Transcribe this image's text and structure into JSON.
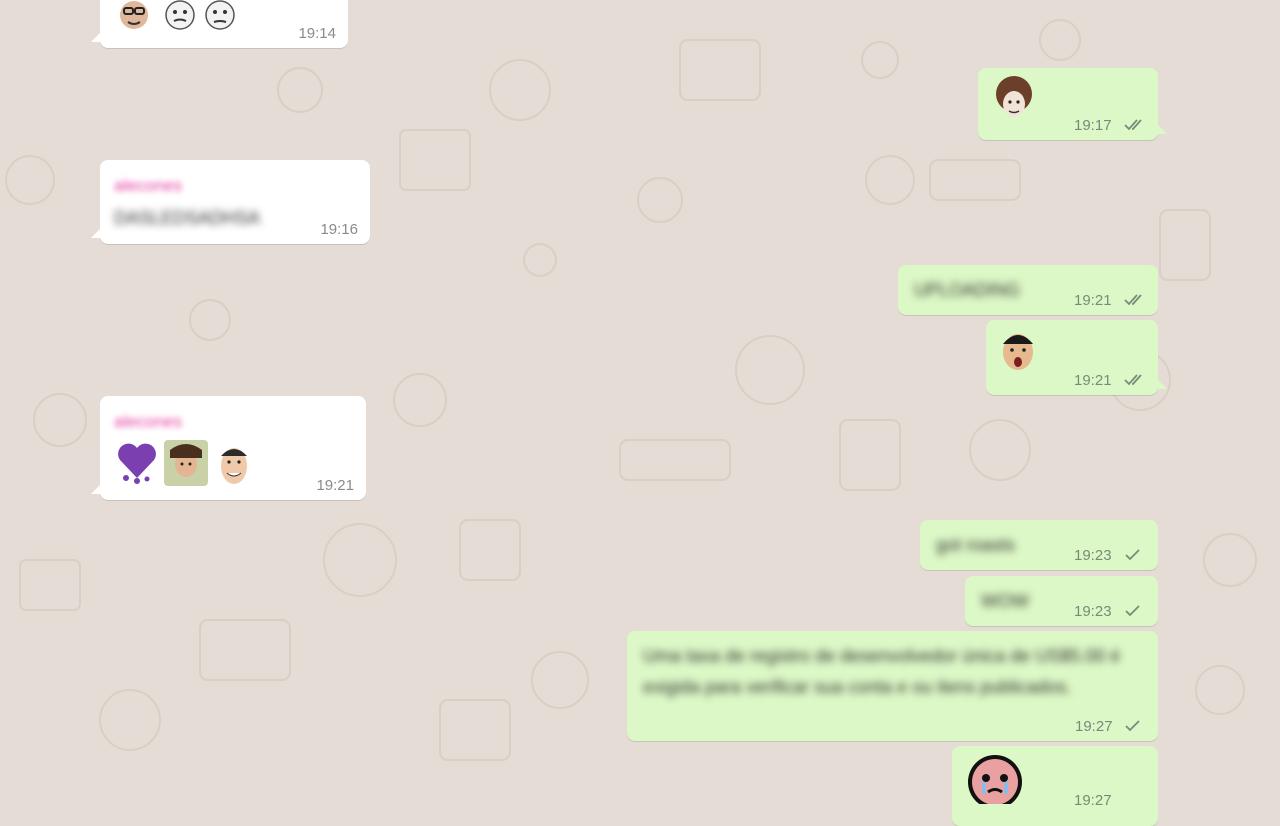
{
  "chat": {
    "messages": [
      {
        "id": "m1",
        "direction": "in",
        "stickers": [
          "face-glasses-emoji",
          "face-bald-emoji",
          "face-bald-emoji-2"
        ],
        "time": "19:14"
      },
      {
        "id": "m2",
        "direction": "out",
        "stickers": [
          "afro-face-emoji"
        ],
        "time": "19:17",
        "status": "read"
      },
      {
        "id": "m3",
        "direction": "in",
        "sender": "alecones",
        "text": "DASLEDSADHSA",
        "time": "19:16"
      },
      {
        "id": "m4",
        "direction": "out",
        "text": "UPLOADING",
        "time": "19:21",
        "status": "read"
      },
      {
        "id": "m5",
        "direction": "out",
        "stickers": [
          "shocked-face-emoji"
        ],
        "time": "19:21",
        "status": "read"
      },
      {
        "id": "m6",
        "direction": "in",
        "sender": "alecones",
        "stickers": [
          "purple-melting-heart-emoji",
          "hands-on-head-emoji",
          "smiling-man-emoji"
        ],
        "time": "19:21"
      },
      {
        "id": "m7",
        "direction": "out",
        "text": "got roasts",
        "time": "19:23",
        "status": "sent"
      },
      {
        "id": "m8",
        "direction": "out",
        "text": "WOW",
        "time": "19:23",
        "status": "sent"
      },
      {
        "id": "m9",
        "direction": "out",
        "text": "Uma taxa de registro de desenvolvedor única de US$5.00 é exigida para verificar sua conta e ou itens publicados.",
        "time": "19:27",
        "status": "sent"
      },
      {
        "id": "m10",
        "direction": "out",
        "stickers": [
          "isaac-crying-emoji"
        ],
        "time": "19:27",
        "status": "sent"
      }
    ]
  },
  "colors": {
    "background": "#e5ddd5",
    "incoming": "#ffffff",
    "outgoing": "#dcf8c6",
    "sender": "#e542a3"
  }
}
